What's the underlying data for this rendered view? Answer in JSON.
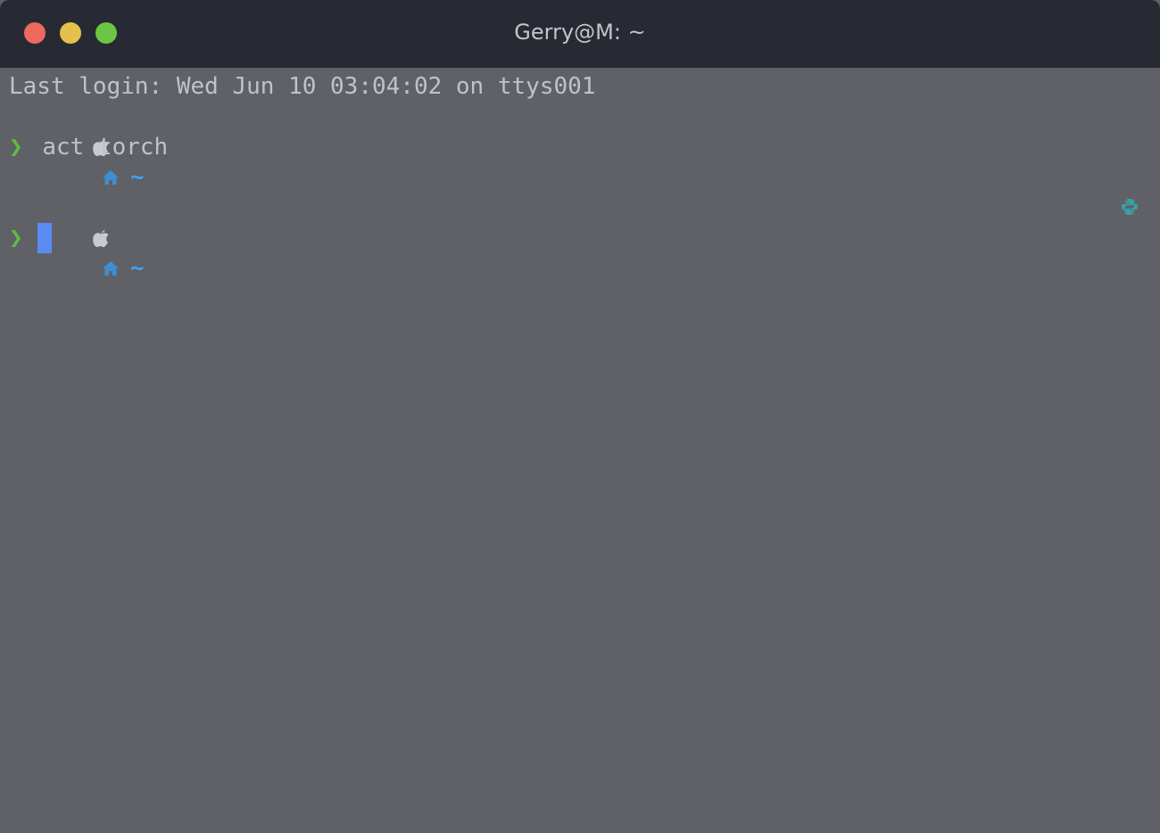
{
  "window": {
    "title": "Gerry@M: ~"
  },
  "terminal": {
    "last_login": "Last login: Wed Jun 10 03:04:02 on ttys001",
    "prompt_path": "~",
    "prompt_symbol": "❯",
    "command_1": "act torch",
    "prompt_2_path": "~",
    "prompt_2_symbol": "❯"
  },
  "colors": {
    "background": "#5f6166",
    "titlebar": "#272a32",
    "prompt_green": "#5fbd3c",
    "path_blue": "#3fa2e8",
    "cursor_blue": "#5b8cf4"
  },
  "icons": {
    "os": "apple-icon",
    "home": "home-icon",
    "env": "python-icon"
  }
}
